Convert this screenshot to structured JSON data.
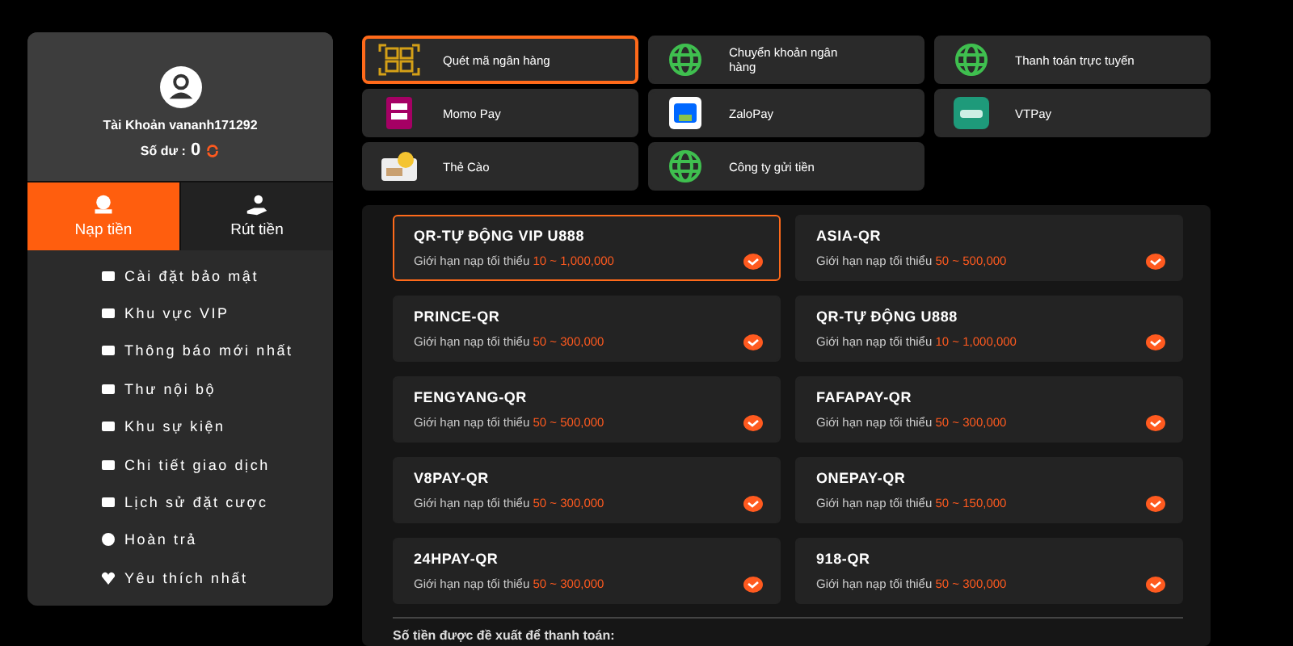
{
  "profile": {
    "account": "Tài Khoản vananh171292",
    "balance_label": "Số dư :",
    "balance": "0"
  },
  "tabs": [
    {
      "label": "Nạp tiền",
      "selected": true
    },
    {
      "label": "Rút tiền",
      "selected": false
    }
  ],
  "menu": [
    "Cài đặt bảo mật",
    "Khu vực VIP",
    "Thông báo mới nhất",
    "Thư nội bộ",
    "Khu sự kiện",
    "Chi tiết giao dịch",
    "Lịch sử đặt cược",
    "Hoàn trả",
    "Yêu thích nhất"
  ],
  "methods": [
    {
      "label": "Quét mã ngân hàng",
      "kind": "qr",
      "selected": true
    },
    {
      "label": "Chuyển khoản ngân hàng",
      "kind": "globe",
      "selected": false
    },
    {
      "label": "Thanh toán trực tuyến",
      "kind": "globe",
      "selected": false
    },
    {
      "label": "Momo Pay",
      "kind": "momo",
      "selected": false
    },
    {
      "label": "ZaloPay",
      "kind": "zalo",
      "selected": false
    },
    {
      "label": "VTPay",
      "kind": "vtpay",
      "selected": false
    },
    {
      "label": "Thẻ Cào",
      "kind": "card",
      "selected": false
    },
    {
      "label": "Công ty gửi tiền",
      "kind": "globe",
      "selected": false
    }
  ],
  "channels": [
    {
      "name": "QR-TỰ ĐỘNG VIP U888",
      "limit": "Giới hạn nạp tối thiểu",
      "range": "10 ~ 1,000,000",
      "selected": true
    },
    {
      "name": "ASIA-QR",
      "limit": "Giới hạn nạp tối thiểu",
      "range": "50 ~ 500,000",
      "selected": false
    },
    {
      "name": "PRINCE-QR",
      "limit": "Giới hạn nạp tối thiểu",
      "range": "50 ~ 300,000",
      "selected": false
    },
    {
      "name": "QR-TỰ ĐỘNG U888",
      "limit": "Giới hạn nạp tối thiểu",
      "range": "10 ~ 1,000,000",
      "selected": false
    },
    {
      "name": "FENGYANG-QR",
      "limit": "Giới hạn nạp tối thiểu",
      "range": "50 ~ 500,000",
      "selected": false
    },
    {
      "name": "FAFAPAY-QR",
      "limit": "Giới hạn nạp tối thiểu",
      "range": "50 ~ 300,000",
      "selected": false
    },
    {
      "name": "V8PAY-QR",
      "limit": "Giới hạn nạp tối thiểu",
      "range": "50 ~ 300,000",
      "selected": false
    },
    {
      "name": "ONEPAY-QR",
      "limit": "Giới hạn nạp tối thiểu",
      "range": "50 ~ 150,000",
      "selected": false
    },
    {
      "name": "24HPAY-QR",
      "limit": "Giới hạn nạp tối thiểu",
      "range": "50 ~ 300,000",
      "selected": false
    },
    {
      "name": "918-QR",
      "limit": "Giới hạn nạp tối thiểu",
      "range": "50 ~ 300,000",
      "selected": false
    }
  ],
  "suggested_label": "Số tiền được đề xuất để thanh toán:"
}
